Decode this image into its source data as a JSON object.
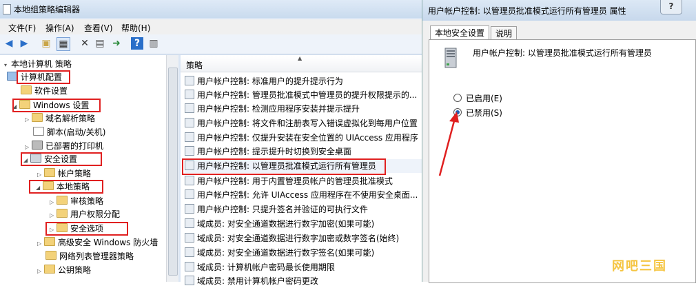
{
  "main_window": {
    "title": "本地组策略编辑器",
    "menu": [
      "文件(F)",
      "操作(A)",
      "查看(V)",
      "帮助(H)"
    ]
  },
  "tree": {
    "root": "本地计算机 策略",
    "items": [
      {
        "label": "计算机配置"
      },
      {
        "label": "软件设置"
      },
      {
        "label": "Windows 设置"
      },
      {
        "label": "域名解析策略"
      },
      {
        "label": "脚本(启动/关机)"
      },
      {
        "label": "已部署的打印机"
      },
      {
        "label": "安全设置"
      },
      {
        "label": "帐户策略"
      },
      {
        "label": "本地策略"
      },
      {
        "label": "审核策略"
      },
      {
        "label": "用户权限分配"
      },
      {
        "label": "安全选项"
      },
      {
        "label": "高级安全 Windows 防火墙"
      },
      {
        "label": "网络列表管理器策略"
      },
      {
        "label": "公钥策略"
      }
    ]
  },
  "list": {
    "header": "策略",
    "rows": [
      "用户帐户控制: 标准用户的提升提示行为",
      "用户帐户控制: 管理员批准模式中管理员的提升权限提示的...",
      "用户帐户控制: 检测应用程序安装并提示提升",
      "用户帐户控制: 将文件和注册表写入错误虚拟化到每用户位置",
      "用户帐户控制: 仅提升安装在安全位置的 UIAccess 应用程序",
      "用户帐户控制: 提示提升时切换到安全桌面",
      "用户帐户控制: 以管理员批准模式运行所有管理员",
      "用户帐户控制: 用于内置管理员帐户的管理员批准模式",
      "用户帐户控制: 允许 UIAccess 应用程序在不使用安全桌面...",
      "用户帐户控制: 只提升签名并验证的可执行文件",
      "域成员: 对安全通道数据进行数字加密(如果可能)",
      "域成员: 对安全通道数据进行数字加密或数字签名(始终)",
      "域成员: 对安全通道数据进行数字签名(如果可能)",
      "域成员: 计算机帐户密码最长使用期限",
      "域成员: 禁用计算机帐户密码更改"
    ]
  },
  "dialog": {
    "title": "用户帐户控制: 以管理员批准模式运行所有管理员 属性",
    "help": "?",
    "tabs": [
      "本地安全设置",
      "说明"
    ],
    "policy_name": "用户帐户控制: 以管理员批准模式运行所有管理员",
    "options": [
      {
        "label": "已启用(E)",
        "selected": false
      },
      {
        "label": "已禁用(S)",
        "selected": true
      }
    ]
  },
  "watermark": "网吧三国",
  "colors": {
    "highlight_box": "#e02020",
    "arrow": "#e02020"
  }
}
